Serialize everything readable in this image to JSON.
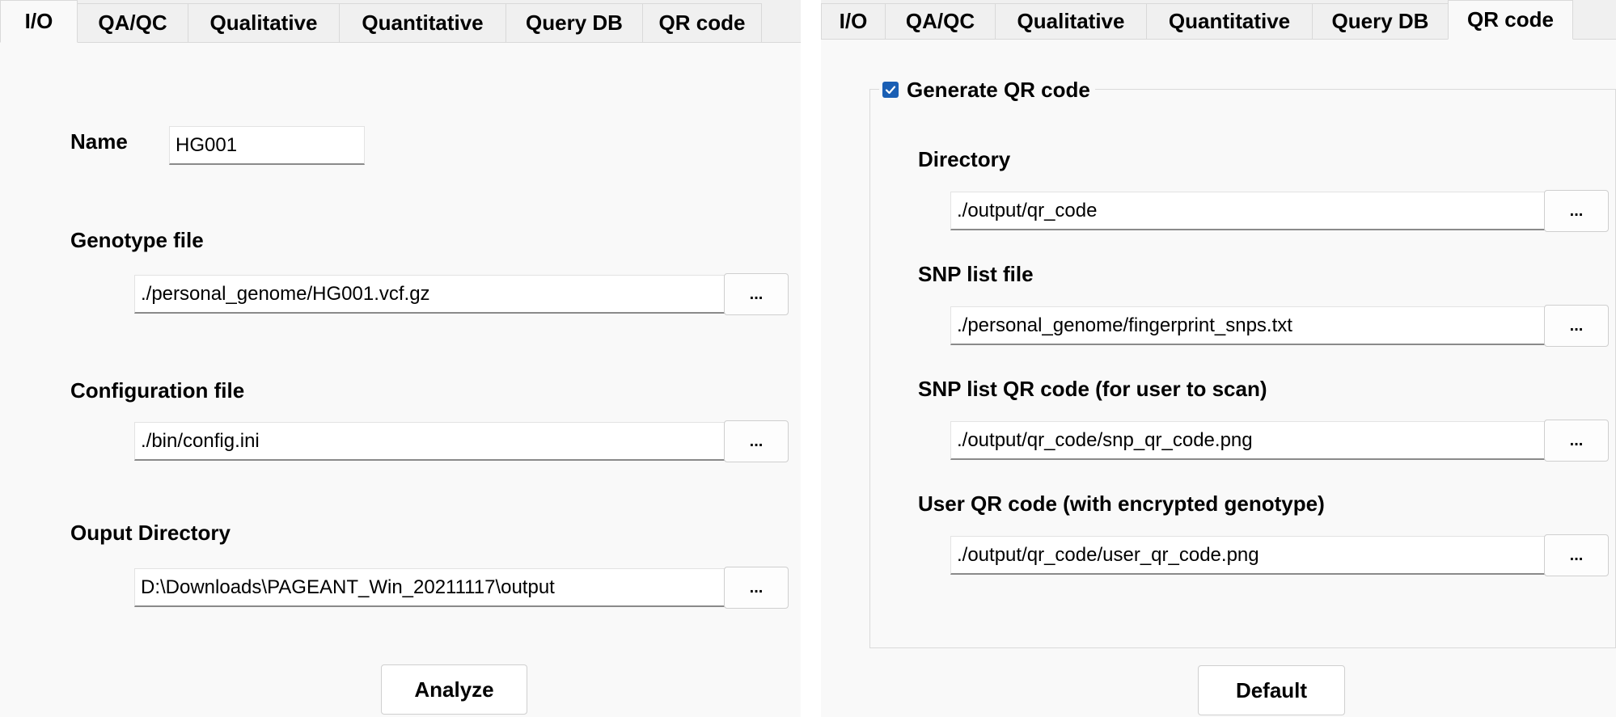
{
  "left": {
    "tabs": [
      "I/O",
      "QA/QC",
      "Qualitative",
      "Quantitative",
      "Query DB",
      "QR code"
    ],
    "name_label": "Name",
    "name_value": "HG001",
    "genotype_label": "Genotype file",
    "genotype_value": "./personal_genome/HG001.vcf.gz",
    "config_label": "Configuration file",
    "config_value": "./bin/config.ini",
    "output_label": "Ouput Directory",
    "output_value": "D:\\Downloads\\PAGEANT_Win_20211117\\output",
    "browse_label": "...",
    "analyze_label": "Analyze"
  },
  "right": {
    "tabs": [
      "I/O",
      "QA/QC",
      "Qualitative",
      "Quantitative",
      "Query DB",
      "QR code"
    ],
    "group_label": "Generate QR code",
    "group_checked": true,
    "directory_label": "Directory",
    "directory_value": "./output/qr_code",
    "snp_list_label": "SNP list file",
    "snp_list_value": "./personal_genome/fingerprint_snps.txt",
    "snp_qr_label": "SNP list QR code (for user to scan)",
    "snp_qr_value": "./output/qr_code/snp_qr_code.png",
    "user_qr_label": "User QR code (with encrypted genotype)",
    "user_qr_value": "./output/qr_code/user_qr_code.png",
    "browse_label": "...",
    "default_label": "Default"
  },
  "colors": {
    "accent": "#1a5fb4",
    "panel_bg": "#f9f9f9",
    "tabbar_bg": "#f0f0f0"
  },
  "icons": {
    "checkbox": "checkmark-icon"
  }
}
